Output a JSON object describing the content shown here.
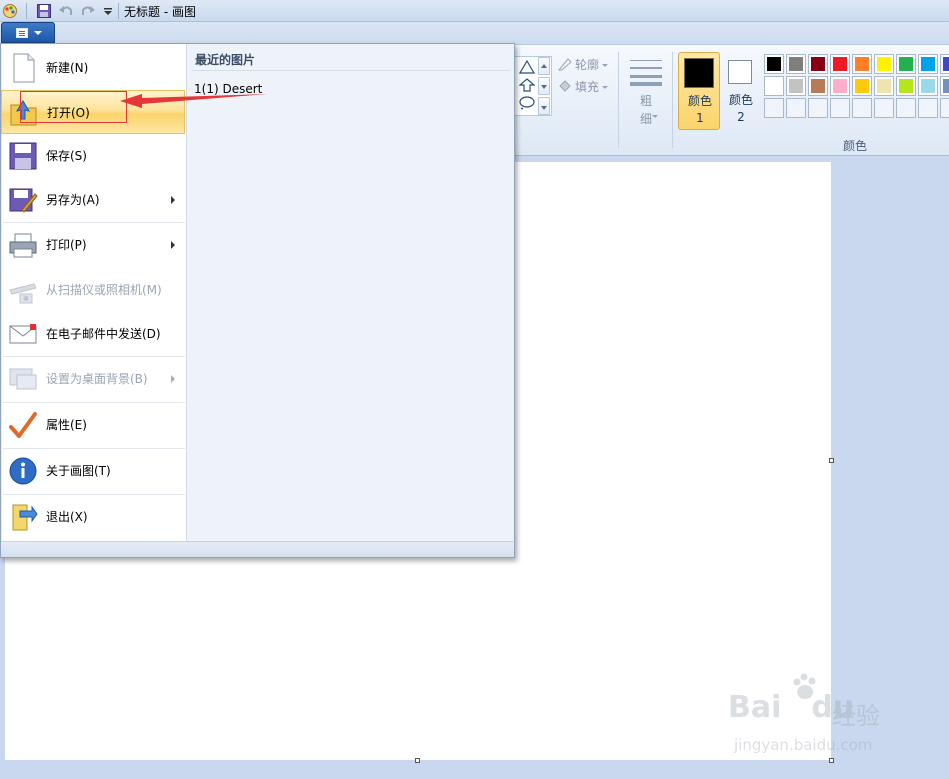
{
  "window": {
    "title": "无标题 - 画图"
  },
  "ribbon": {
    "shapes": {
      "outline_label": "轮廓",
      "fill_label": "填充"
    },
    "size_label": "粗细",
    "color1_label": "颜色 1",
    "color2_label": "颜色 2",
    "colors_group_label": "颜色",
    "color1_value": "#000000",
    "color2_value": "#ffffff",
    "palette_row1": [
      "#000000",
      "#7f7f7f",
      "#880015",
      "#ed1c24",
      "#ff7f27",
      "#fff200",
      "#22b14c",
      "#00a2e8",
      "#3f48cc"
    ],
    "palette_row2": [
      "#ffffff",
      "#c3c3c3",
      "#b97a57",
      "#ffaec9",
      "#ffc90e",
      "#efe4b0",
      "#b5e61d",
      "#99d9ea",
      "#7092be"
    ],
    "palette_row3_count": 9
  },
  "app_menu": {
    "items": [
      {
        "label": "新建(N)",
        "enabled": true,
        "icon": "new-document-icon"
      },
      {
        "label": "打开(O)",
        "enabled": true,
        "icon": "open-folder-icon",
        "highlighted": true
      },
      {
        "label": "保存(S)",
        "enabled": true,
        "icon": "save-disk-icon"
      },
      {
        "label": "另存为(A)",
        "enabled": true,
        "icon": "save-as-icon",
        "submenu": true
      },
      {
        "label": "打印(P)",
        "enabled": true,
        "icon": "printer-icon",
        "submenu": true
      },
      {
        "label": "从扫描仪或照相机(M)",
        "enabled": false,
        "icon": "scanner-icon"
      },
      {
        "label": "在电子邮件中发送(D)",
        "enabled": true,
        "icon": "email-icon"
      },
      {
        "label": "设置为桌面背景(B)",
        "enabled": false,
        "icon": "desktop-background-icon",
        "submenu": true
      },
      {
        "label": "属性(E)",
        "enabled": true,
        "icon": "properties-check-icon"
      },
      {
        "label": "关于画图(T)",
        "enabled": true,
        "icon": "info-icon"
      },
      {
        "label": "退出(X)",
        "enabled": true,
        "icon": "exit-icon"
      }
    ],
    "recent_header": "最近的图片",
    "recent_items": [
      {
        "label": "1(1)  Desert"
      }
    ]
  },
  "watermark": {
    "brand": "Bai",
    "brand_tail": "du",
    "name": "经验",
    "url": "jingyan.baidu.com"
  },
  "annotation": {
    "color": "#e3373a"
  }
}
